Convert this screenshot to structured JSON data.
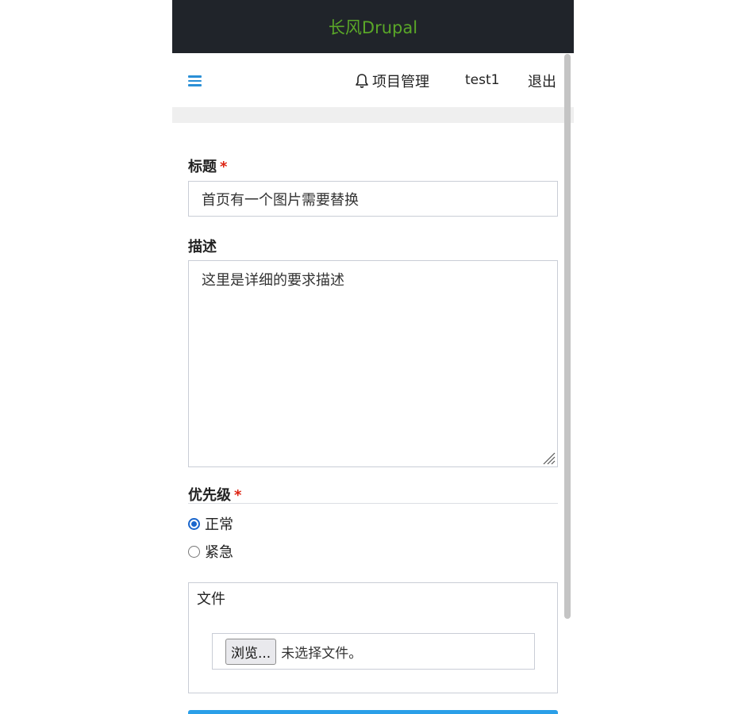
{
  "header": {
    "site_title": "长风Drupal"
  },
  "nav": {
    "projects_label": "项目管理",
    "user_label": "test1",
    "logout_label": "退出"
  },
  "form": {
    "title_label": "标题",
    "title_value": "首页有一个图片需要替换",
    "description_label": "描述",
    "description_value": "这里是详细的要求描述",
    "priority_label": "优先级",
    "required_mark": "*",
    "priority_options": [
      {
        "label": "正常",
        "checked": true
      },
      {
        "label": "紧急",
        "checked": false
      }
    ],
    "file_legend": "文件",
    "browse_label": "浏览...",
    "no_file_text": "未选择文件。"
  },
  "colors": {
    "accent": "#2a8fd6",
    "brand_title": "#5aa728",
    "topbar": "#20242a",
    "required": "#dd1111"
  }
}
